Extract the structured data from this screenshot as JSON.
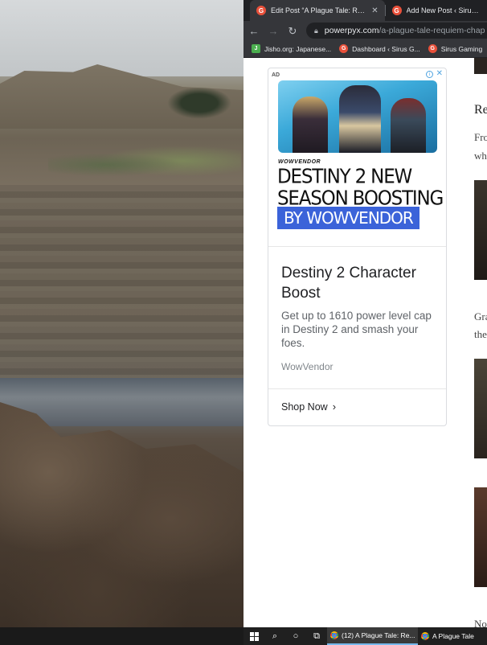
{
  "browser": {
    "tabs": [
      {
        "title": "Edit Post “A Plague Tale: Requiem",
        "active": true
      },
      {
        "title": "Add New Post ‹ Sirus Ga",
        "active": false
      }
    ],
    "url_host": "powerpyx.com",
    "url_path": "/a-plague-tale-requiem-chap",
    "bookmarks": [
      {
        "label": "Jisho.org: Japanese...",
        "icon": "jisho-icon"
      },
      {
        "label": "Dashboard ‹ Sirus G...",
        "icon": "sirus-icon"
      },
      {
        "label": "Sirus Gaming",
        "icon": "sirus-icon"
      }
    ]
  },
  "ad": {
    "label": "AD",
    "brand": "WOWVENDOR",
    "headline_line1": "DESTINY 2 NEW",
    "headline_line2": "SEASON BOOSTING",
    "headline_pill": "BY WOWVENDOR",
    "title": "Destiny 2 Character Boost",
    "description": "Get up to 1610 power level cap in Destiny 2 and smash your foes.",
    "advertiser": "WowVendor",
    "cta": "Shop Now",
    "colors": {
      "pill": "#3b63d9",
      "info": "#4fa3e0"
    }
  },
  "article": {
    "heading_fragment": "Re",
    "p1_line1": "Fro",
    "p1_line2": "wh",
    "p2_line1": "Gra",
    "p2_line2": "the",
    "p3_line1": "No"
  },
  "taskbar": {
    "apps": [
      {
        "label": "(12) A Plague Tale: Re...",
        "active": true
      },
      {
        "label": "A Plague Tale",
        "active": false
      }
    ]
  }
}
